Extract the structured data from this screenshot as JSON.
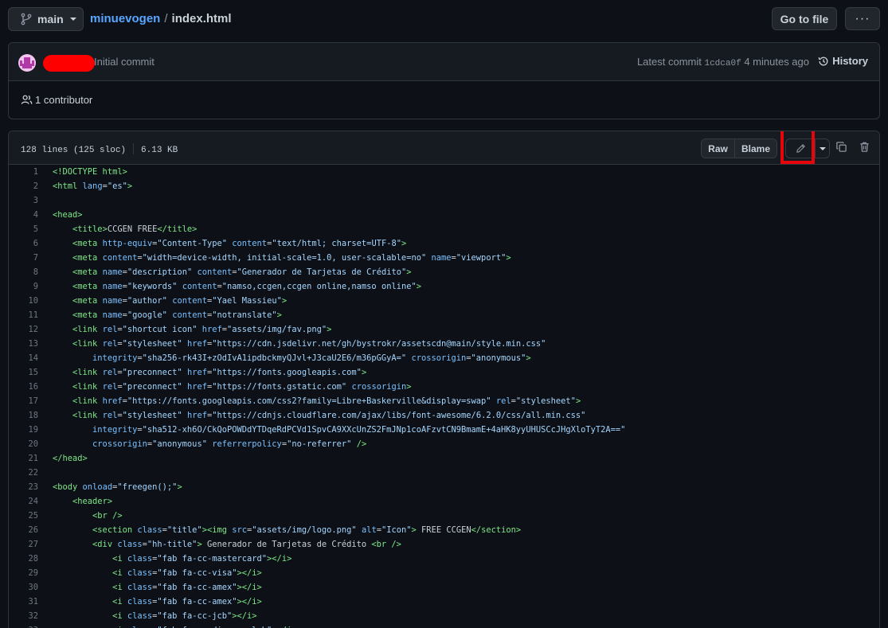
{
  "header": {
    "branch": "main",
    "repo": "minuevogen",
    "separator": "/",
    "file": "index.html",
    "goto_label": "Go to file",
    "more_label": "···"
  },
  "commit": {
    "message": "Initial commit",
    "latest_label": "Latest commit",
    "sha": "1cdca0f",
    "time": "4 minutes ago",
    "history_label": "History",
    "contributors": "1 contributor"
  },
  "file_header": {
    "lines_info": "128 lines (125 sloc)",
    "size": "6.13 KB",
    "raw_label": "Raw",
    "blame_label": "Blame"
  },
  "icons": [
    "git-branch-icon",
    "history-icon",
    "people-icon",
    "pencil-icon",
    "chevron-down-icon",
    "copy-icon",
    "trash-icon",
    "kebab-icon"
  ],
  "colors": {
    "background": "#0d1117",
    "link": "#58a6ff",
    "tag": "#7ee787",
    "attr": "#79c0ff",
    "string": "#a5d6ff",
    "highlight": "#e5050b"
  },
  "code_lines": [
    {
      "n": "1",
      "seg": [
        [
          "t",
          "<!DOCTYPE html>"
        ]
      ]
    },
    {
      "n": "2",
      "seg": [
        [
          "t",
          "<html "
        ],
        [
          "a",
          "lang"
        ],
        [
          "p",
          "="
        ],
        [
          "s",
          "\"es\""
        ],
        [
          "t",
          ">"
        ]
      ]
    },
    {
      "n": "3",
      "seg": []
    },
    {
      "n": "4",
      "seg": [
        [
          "t",
          "<head>"
        ]
      ]
    },
    {
      "n": "5",
      "seg": [
        [
          "p",
          "    "
        ],
        [
          "t",
          "<title>"
        ],
        [
          "p",
          "CCGEN FREE"
        ],
        [
          "t",
          "</title>"
        ]
      ]
    },
    {
      "n": "6",
      "seg": [
        [
          "p",
          "    "
        ],
        [
          "t",
          "<meta "
        ],
        [
          "a",
          "http-equiv"
        ],
        [
          "p",
          "="
        ],
        [
          "s",
          "\"Content-Type\""
        ],
        [
          "p",
          " "
        ],
        [
          "a",
          "content"
        ],
        [
          "p",
          "="
        ],
        [
          "s",
          "\"text/html; charset=UTF-8\""
        ],
        [
          "t",
          ">"
        ]
      ]
    },
    {
      "n": "7",
      "seg": [
        [
          "p",
          "    "
        ],
        [
          "t",
          "<meta "
        ],
        [
          "a",
          "content"
        ],
        [
          "p",
          "="
        ],
        [
          "s",
          "\"width=device-width, initial-scale=1.0, user-scalable=no\""
        ],
        [
          "p",
          " "
        ],
        [
          "a",
          "name"
        ],
        [
          "p",
          "="
        ],
        [
          "s",
          "\"viewport\""
        ],
        [
          "t",
          ">"
        ]
      ]
    },
    {
      "n": "8",
      "seg": [
        [
          "p",
          "    "
        ],
        [
          "t",
          "<meta "
        ],
        [
          "a",
          "name"
        ],
        [
          "p",
          "="
        ],
        [
          "s",
          "\"description\""
        ],
        [
          "p",
          " "
        ],
        [
          "a",
          "content"
        ],
        [
          "p",
          "="
        ],
        [
          "s",
          "\"Generador de Tarjetas de Crédito\""
        ],
        [
          "t",
          ">"
        ]
      ]
    },
    {
      "n": "9",
      "seg": [
        [
          "p",
          "    "
        ],
        [
          "t",
          "<meta "
        ],
        [
          "a",
          "name"
        ],
        [
          "p",
          "="
        ],
        [
          "s",
          "\"keywords\""
        ],
        [
          "p",
          " "
        ],
        [
          "a",
          "content"
        ],
        [
          "p",
          "="
        ],
        [
          "s",
          "\"namso,ccgen,ccgen online,namso online\""
        ],
        [
          "t",
          ">"
        ]
      ]
    },
    {
      "n": "10",
      "seg": [
        [
          "p",
          "    "
        ],
        [
          "t",
          "<meta "
        ],
        [
          "a",
          "name"
        ],
        [
          "p",
          "="
        ],
        [
          "s",
          "\"author\""
        ],
        [
          "p",
          " "
        ],
        [
          "a",
          "content"
        ],
        [
          "p",
          "="
        ],
        [
          "s",
          "\"Yael Massieu\""
        ],
        [
          "t",
          ">"
        ]
      ]
    },
    {
      "n": "11",
      "seg": [
        [
          "p",
          "    "
        ],
        [
          "t",
          "<meta "
        ],
        [
          "a",
          "name"
        ],
        [
          "p",
          "="
        ],
        [
          "s",
          "\"google\""
        ],
        [
          "p",
          " "
        ],
        [
          "a",
          "content"
        ],
        [
          "p",
          "="
        ],
        [
          "s",
          "\"notranslate\""
        ],
        [
          "t",
          ">"
        ]
      ]
    },
    {
      "n": "12",
      "seg": [
        [
          "p",
          "    "
        ],
        [
          "t",
          "<link "
        ],
        [
          "a",
          "rel"
        ],
        [
          "p",
          "="
        ],
        [
          "s",
          "\"shortcut icon\""
        ],
        [
          "p",
          " "
        ],
        [
          "a",
          "href"
        ],
        [
          "p",
          "="
        ],
        [
          "s",
          "\"assets/img/fav.png\""
        ],
        [
          "t",
          ">"
        ]
      ]
    },
    {
      "n": "13",
      "seg": [
        [
          "p",
          "    "
        ],
        [
          "t",
          "<link "
        ],
        [
          "a",
          "rel"
        ],
        [
          "p",
          "="
        ],
        [
          "s",
          "\"stylesheet\""
        ],
        [
          "p",
          " "
        ],
        [
          "a",
          "href"
        ],
        [
          "p",
          "="
        ],
        [
          "s",
          "\"https://cdn.jsdelivr.net/gh/bystrokr/assetscdn@main/style.min.css\""
        ]
      ]
    },
    {
      "n": "14",
      "seg": [
        [
          "p",
          "        "
        ],
        [
          "a",
          "integrity"
        ],
        [
          "p",
          "="
        ],
        [
          "s",
          "\"sha256-rk43I+zOdIvA1ipdbckmyQJvl+J3caU2E6/m36pGGyA=\""
        ],
        [
          "p",
          " "
        ],
        [
          "a",
          "crossorigin"
        ],
        [
          "p",
          "="
        ],
        [
          "s",
          "\"anonymous\""
        ],
        [
          "t",
          ">"
        ]
      ]
    },
    {
      "n": "15",
      "seg": [
        [
          "p",
          "    "
        ],
        [
          "t",
          "<link "
        ],
        [
          "a",
          "rel"
        ],
        [
          "p",
          "="
        ],
        [
          "s",
          "\"preconnect\""
        ],
        [
          "p",
          " "
        ],
        [
          "a",
          "href"
        ],
        [
          "p",
          "="
        ],
        [
          "s",
          "\"https://fonts.googleapis.com\""
        ],
        [
          "t",
          ">"
        ]
      ]
    },
    {
      "n": "16",
      "seg": [
        [
          "p",
          "    "
        ],
        [
          "t",
          "<link "
        ],
        [
          "a",
          "rel"
        ],
        [
          "p",
          "="
        ],
        [
          "s",
          "\"preconnect\""
        ],
        [
          "p",
          " "
        ],
        [
          "a",
          "href"
        ],
        [
          "p",
          "="
        ],
        [
          "s",
          "\"https://fonts.gstatic.com\""
        ],
        [
          "p",
          " "
        ],
        [
          "a",
          "crossorigin"
        ],
        [
          "t",
          ">"
        ]
      ]
    },
    {
      "n": "17",
      "seg": [
        [
          "p",
          "    "
        ],
        [
          "t",
          "<link "
        ],
        [
          "a",
          "href"
        ],
        [
          "p",
          "="
        ],
        [
          "s",
          "\"https://fonts.googleapis.com/css2?family=Libre+Baskerville&display=swap\""
        ],
        [
          "p",
          " "
        ],
        [
          "a",
          "rel"
        ],
        [
          "p",
          "="
        ],
        [
          "s",
          "\"stylesheet\""
        ],
        [
          "t",
          ">"
        ]
      ]
    },
    {
      "n": "18",
      "seg": [
        [
          "p",
          "    "
        ],
        [
          "t",
          "<link "
        ],
        [
          "a",
          "rel"
        ],
        [
          "p",
          "="
        ],
        [
          "s",
          "\"stylesheet\""
        ],
        [
          "p",
          " "
        ],
        [
          "a",
          "href"
        ],
        [
          "p",
          "="
        ],
        [
          "s",
          "\"https://cdnjs.cloudflare.com/ajax/libs/font-awesome/6.2.0/css/all.min.css\""
        ]
      ]
    },
    {
      "n": "19",
      "seg": [
        [
          "p",
          "        "
        ],
        [
          "a",
          "integrity"
        ],
        [
          "p",
          "="
        ],
        [
          "s",
          "\"sha512-xh6O/CkQoPOWDdYTDqeRdPCVd1SpvCA9XXcUnZS2FmJNp1coAFzvtCN9BmamE+4aHK8yyUHUSCcJHgXloTyT2A==\""
        ]
      ]
    },
    {
      "n": "20",
      "seg": [
        [
          "p",
          "        "
        ],
        [
          "a",
          "crossorigin"
        ],
        [
          "p",
          "="
        ],
        [
          "s",
          "\"anonymous\""
        ],
        [
          "p",
          " "
        ],
        [
          "a",
          "referrerpolicy"
        ],
        [
          "p",
          "="
        ],
        [
          "s",
          "\"no-referrer\""
        ],
        [
          "p",
          " "
        ],
        [
          "t",
          "/>"
        ]
      ]
    },
    {
      "n": "21",
      "seg": [
        [
          "t",
          "</head>"
        ]
      ]
    },
    {
      "n": "22",
      "seg": []
    },
    {
      "n": "23",
      "seg": [
        [
          "t",
          "<body "
        ],
        [
          "a",
          "onload"
        ],
        [
          "p",
          "="
        ],
        [
          "s",
          "\"freegen();\""
        ],
        [
          "t",
          ">"
        ]
      ]
    },
    {
      "n": "24",
      "seg": [
        [
          "p",
          "    "
        ],
        [
          "t",
          "<header>"
        ]
      ]
    },
    {
      "n": "25",
      "seg": [
        [
          "p",
          "        "
        ],
        [
          "t",
          "<br />"
        ]
      ]
    },
    {
      "n": "26",
      "seg": [
        [
          "p",
          "        "
        ],
        [
          "t",
          "<section "
        ],
        [
          "a",
          "class"
        ],
        [
          "p",
          "="
        ],
        [
          "s",
          "\"title\""
        ],
        [
          "t",
          "><img "
        ],
        [
          "a",
          "src"
        ],
        [
          "p",
          "="
        ],
        [
          "s",
          "\"assets/img/logo.png\""
        ],
        [
          "p",
          " "
        ],
        [
          "a",
          "alt"
        ],
        [
          "p",
          "="
        ],
        [
          "s",
          "\"Icon\""
        ],
        [
          "t",
          ">"
        ],
        [
          "p",
          " FREE CCGEN"
        ],
        [
          "t",
          "</section>"
        ]
      ]
    },
    {
      "n": "27",
      "seg": [
        [
          "p",
          "        "
        ],
        [
          "t",
          "<div "
        ],
        [
          "a",
          "class"
        ],
        [
          "p",
          "="
        ],
        [
          "s",
          "\"hh-title\""
        ],
        [
          "t",
          ">"
        ],
        [
          "p",
          " Generador de Tarjetas de Crédito "
        ],
        [
          "t",
          "<br />"
        ]
      ]
    },
    {
      "n": "28",
      "seg": [
        [
          "p",
          "            "
        ],
        [
          "t",
          "<i "
        ],
        [
          "a",
          "class"
        ],
        [
          "p",
          "="
        ],
        [
          "s",
          "\"fab fa-cc-mastercard\""
        ],
        [
          "t",
          "></i>"
        ]
      ]
    },
    {
      "n": "29",
      "seg": [
        [
          "p",
          "            "
        ],
        [
          "t",
          "<i "
        ],
        [
          "a",
          "class"
        ],
        [
          "p",
          "="
        ],
        [
          "s",
          "\"fab fa-cc-visa\""
        ],
        [
          "t",
          "></i>"
        ]
      ]
    },
    {
      "n": "30",
      "seg": [
        [
          "p",
          "            "
        ],
        [
          "t",
          "<i "
        ],
        [
          "a",
          "class"
        ],
        [
          "p",
          "="
        ],
        [
          "s",
          "\"fab fa-cc-amex\""
        ],
        [
          "t",
          "></i>"
        ]
      ]
    },
    {
      "n": "31",
      "seg": [
        [
          "p",
          "            "
        ],
        [
          "t",
          "<i "
        ],
        [
          "a",
          "class"
        ],
        [
          "p",
          "="
        ],
        [
          "s",
          "\"fab fa-cc-amex\""
        ],
        [
          "t",
          "></i>"
        ]
      ]
    },
    {
      "n": "32",
      "seg": [
        [
          "p",
          "            "
        ],
        [
          "t",
          "<i "
        ],
        [
          "a",
          "class"
        ],
        [
          "p",
          "="
        ],
        [
          "s",
          "\"fab fa-cc-jcb\""
        ],
        [
          "t",
          "></i>"
        ]
      ]
    },
    {
      "n": "33",
      "seg": [
        [
          "p",
          "            "
        ],
        [
          "t",
          "<i "
        ],
        [
          "a",
          "class"
        ],
        [
          "p",
          "="
        ],
        [
          "s",
          "\"fab fa-cc-diners-club\""
        ],
        [
          "t",
          "></i>"
        ]
      ]
    }
  ]
}
